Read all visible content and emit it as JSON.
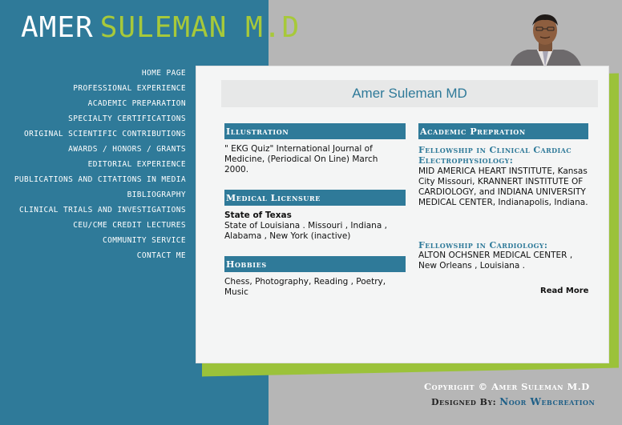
{
  "logo": {
    "first": "AMER",
    "last": "SULEMAN M.D"
  },
  "nav": [
    "HOME PAGE",
    "PROFESSIONAL EXPERIENCE",
    "ACADEMIC PREPARATION",
    "SPECIALTY CERTIFICATIONS",
    "ORIGINAL SCIENTIFIC CONTRIBUTIONS",
    "AWARDS / HONORS / GRANTS",
    "EDITORIAL EXPERIENCE",
    "PUBLICATIONS AND CITATIONS IN MEDIA",
    "BIBLIOGRAPHY",
    "CLINICAL TRIALS AND INVESTIGATIONS",
    "CEU/CME CREDIT LECTURES",
    "COMMUNITY SERVICE",
    "CONTACT ME"
  ],
  "header": {
    "title": "Amer Suleman MD"
  },
  "illustration": {
    "title": "Illustration",
    "text": "\" EKG Quiz\" International Journal of Medicine, (Periodical On Line) March 2000."
  },
  "licensure": {
    "title": "Medical Licensure",
    "state": "State of Texas",
    "text": "State of Louisiana . Missouri , Indiana , Alabama , New York (inactive)"
  },
  "hobbies": {
    "title": "Hobbies",
    "text": "Chess, Photography, Reading , Poetry, Music"
  },
  "academic": {
    "title": "Academic Prepration",
    "fellowship1_title": "Fellowship in Clinical Cardiac Electrophysiology:",
    "fellowship1_text": "MID AMERICA HEART INSTITUTE, Kansas City Missouri, KRANNERT INSTITUTE OF CARDIOLOGY, and INDIANA UNIVERSITY MEDICAL CENTER, Indianapolis, Indiana.",
    "fellowship2_title": "Fellowship in Cardiology:",
    "fellowship2_text": "ALTON OCHSNER MEDICAL CENTER , New Orleans , Louisiana .",
    "read_more": "Read More"
  },
  "footer": {
    "copyright": "Copyright © Amer Suleman M.D",
    "designed_prefix": "Designed By:",
    "designed_brand": "Noor Webcreation"
  },
  "colors": {
    "teal": "#2f7a99",
    "green": "#9bc23a",
    "gray": "#b6b6b6"
  },
  "icons": {
    "nav_bullet": "square-bullet-icon",
    "photo": "portrait-photo"
  }
}
